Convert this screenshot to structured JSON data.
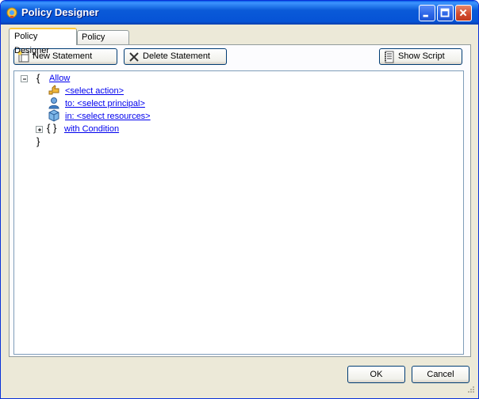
{
  "window": {
    "title": "Policy Designer",
    "icons": {
      "app": "policy-app-icon",
      "minimize": "minimize-icon",
      "maximize": "maximize-icon",
      "close": "close-icon"
    }
  },
  "tabs": [
    {
      "label": "Policy Designer",
      "active": true
    },
    {
      "label": "Policy Script",
      "active": false
    }
  ],
  "toolbar": {
    "new_statement": "New Statement",
    "delete_statement": "Delete Statement",
    "show_script": "Show Script"
  },
  "tree": {
    "open_brace": "{",
    "allow": "Allow",
    "action": "<select action>",
    "principal": "to: <select principal>",
    "resources": "in: <select resources>",
    "condition_braces": "{ }",
    "condition": "with Condition",
    "close_brace": "}"
  },
  "footer": {
    "ok": "OK",
    "cancel": "Cancel"
  },
  "colors": {
    "titlebar": "#0653d6",
    "link": "#0000ee",
    "face": "#ece9d8",
    "tab_highlight": "#ffc83c"
  }
}
